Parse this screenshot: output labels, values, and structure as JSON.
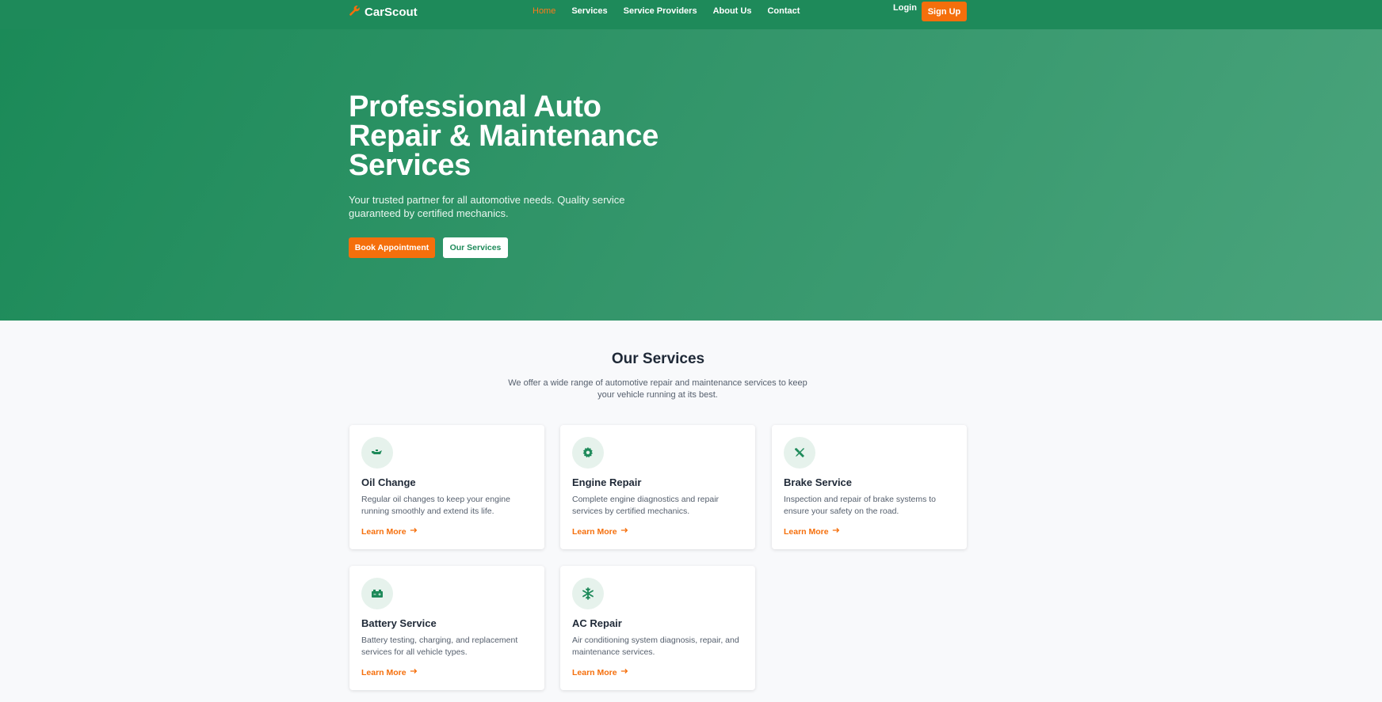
{
  "brand": {
    "name": "CarScout",
    "accent": "#f56f0c",
    "primary": "#1e8a5a"
  },
  "nav": {
    "items": [
      {
        "label": "Home",
        "active": true
      },
      {
        "label": "Services",
        "active": false
      },
      {
        "label": "Service Providers",
        "active": false
      },
      {
        "label": "About Us",
        "active": false
      },
      {
        "label": "Contact",
        "active": false
      }
    ],
    "login_label": "Login",
    "signup_label": "Sign Up"
  },
  "hero": {
    "title": "Professional Auto Repair & Maintenance Services",
    "subtitle": "Your trusted partner for all automotive needs. Quality service guaranteed by certified mechanics.",
    "primary_button": "Book Appointment",
    "secondary_button": "Our Services"
  },
  "services": {
    "title": "Our Services",
    "description": "We offer a wide range of automotive repair and maintenance services to keep your vehicle running at its best.",
    "cards": [
      {
        "icon": "oil-can-icon",
        "title": "Oil Change",
        "description": "Regular oil changes to keep your engine running smoothly and extend its life.",
        "link": "Learn More"
      },
      {
        "icon": "gear-icon",
        "title": "Engine Repair",
        "description": "Complete engine diagnostics and repair services by certified mechanics.",
        "link": "Learn More"
      },
      {
        "icon": "tools-icon",
        "title": "Brake Service",
        "description": "Inspection and repair of brake systems to ensure your safety on the road.",
        "link": "Learn More"
      },
      {
        "icon": "battery-icon",
        "title": "Battery Service",
        "description": "Battery testing, charging, and replacement services for all vehicle types.",
        "link": "Learn More"
      },
      {
        "icon": "snowflake-icon",
        "title": "AC Repair",
        "description": "Air conditioning system diagnosis, repair, and maintenance services.",
        "link": "Learn More"
      }
    ]
  }
}
